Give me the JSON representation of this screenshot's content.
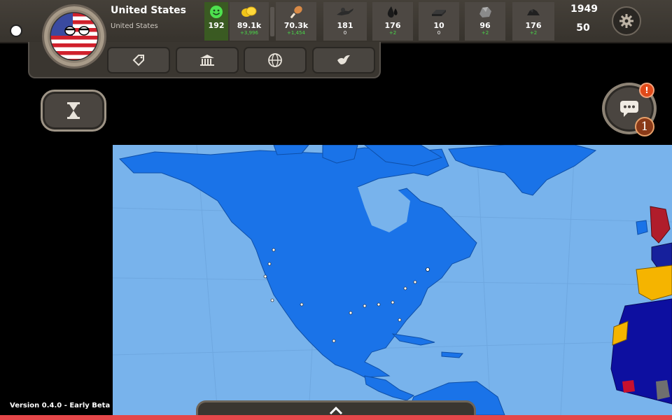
{
  "country": {
    "name": "United States",
    "subtitle": "United States"
  },
  "resources": [
    {
      "id": "happiness",
      "value": "192",
      "change": "",
      "change_type": "neutral",
      "icon": "smiley-icon"
    },
    {
      "id": "money",
      "value": "89.1k",
      "change": "+3,996",
      "change_type": "positive",
      "icon": "coins-icon"
    },
    {
      "id": "food",
      "value": "70.3k",
      "change": "+1,454",
      "change_type": "positive",
      "icon": "meat-icon"
    },
    {
      "id": "manpower",
      "value": "181",
      "change": "0",
      "change_type": "neutral",
      "icon": "soldiers-icon"
    },
    {
      "id": "oil",
      "value": "176",
      "change": "+2",
      "change_type": "positive",
      "icon": "oil-drop-icon"
    },
    {
      "id": "steel",
      "value": "10",
      "change": "0",
      "change_type": "neutral",
      "icon": "steel-icon"
    },
    {
      "id": "iron",
      "value": "96",
      "change": "+2",
      "change_type": "positive",
      "icon": "iron-ore-icon"
    },
    {
      "id": "coal",
      "value": "176",
      "change": "+2",
      "change_type": "positive",
      "icon": "coal-icon"
    }
  ],
  "date": {
    "year": "1949",
    "day": "50"
  },
  "subbar_buttons": [
    "trade-tag-icon",
    "parliament-icon",
    "diplomacy-globe-icon",
    "peace-dove-icon"
  ],
  "footer": {
    "version": "Version 0.4.0 - Early Beta"
  },
  "chat": {
    "alert": "!",
    "count": "1"
  },
  "colors": {
    "ocean": "#78b3ec",
    "usa": "#1a73e8",
    "positive_change": "#49d849",
    "alert": "#e04a1a"
  }
}
